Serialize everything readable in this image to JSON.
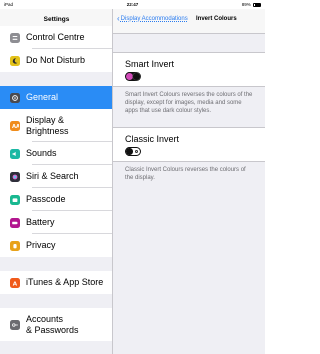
{
  "status_bar": {
    "left": "iPad",
    "time": "22:47",
    "battery": "89%"
  },
  "sidebar": {
    "title": "Settings",
    "items": [
      {
        "label": "Control Centre",
        "icon": "control-centre-icon",
        "color": "#8e8e93"
      },
      {
        "label": "Do Not Disturb",
        "icon": "moon-icon",
        "color": "#e3c21a"
      },
      {
        "label": "General",
        "icon": "gear-icon",
        "color": "#4a4a4f",
        "selected": true
      },
      {
        "label": "Display &\nBrightness",
        "icon": "display-icon",
        "color": "#f08c1b"
      },
      {
        "label": "Sounds",
        "icon": "speaker-icon",
        "color": "#1bb8a4"
      },
      {
        "label": "Siri & Search",
        "icon": "siri-icon",
        "color": "#2e2e3a"
      },
      {
        "label": "Passcode",
        "icon": "passcode-icon",
        "color": "#19b890"
      },
      {
        "label": "Battery",
        "icon": "battery-icon",
        "color": "#b3168f"
      },
      {
        "label": "Privacy",
        "icon": "hand-icon",
        "color": "#e8a21a"
      },
      {
        "label": "iTunes & App Store",
        "icon": "app-store-icon",
        "color": "#f05a1b"
      },
      {
        "label": "Accounts\n& Passwords",
        "icon": "key-icon",
        "color": "#6b6b70"
      }
    ]
  },
  "detail": {
    "back_label": "Display Accommodations",
    "title": "Invert Colours",
    "smart_invert": {
      "label": "Smart Invert",
      "state": "on",
      "note": "Smart Invert Colours reverses the colours of the display, except for images, media and some apps that use dark colour styles."
    },
    "classic_invert": {
      "label": "Classic Invert",
      "state": "off",
      "note": "Classic Invert Colours reverses the colours of the display."
    }
  }
}
